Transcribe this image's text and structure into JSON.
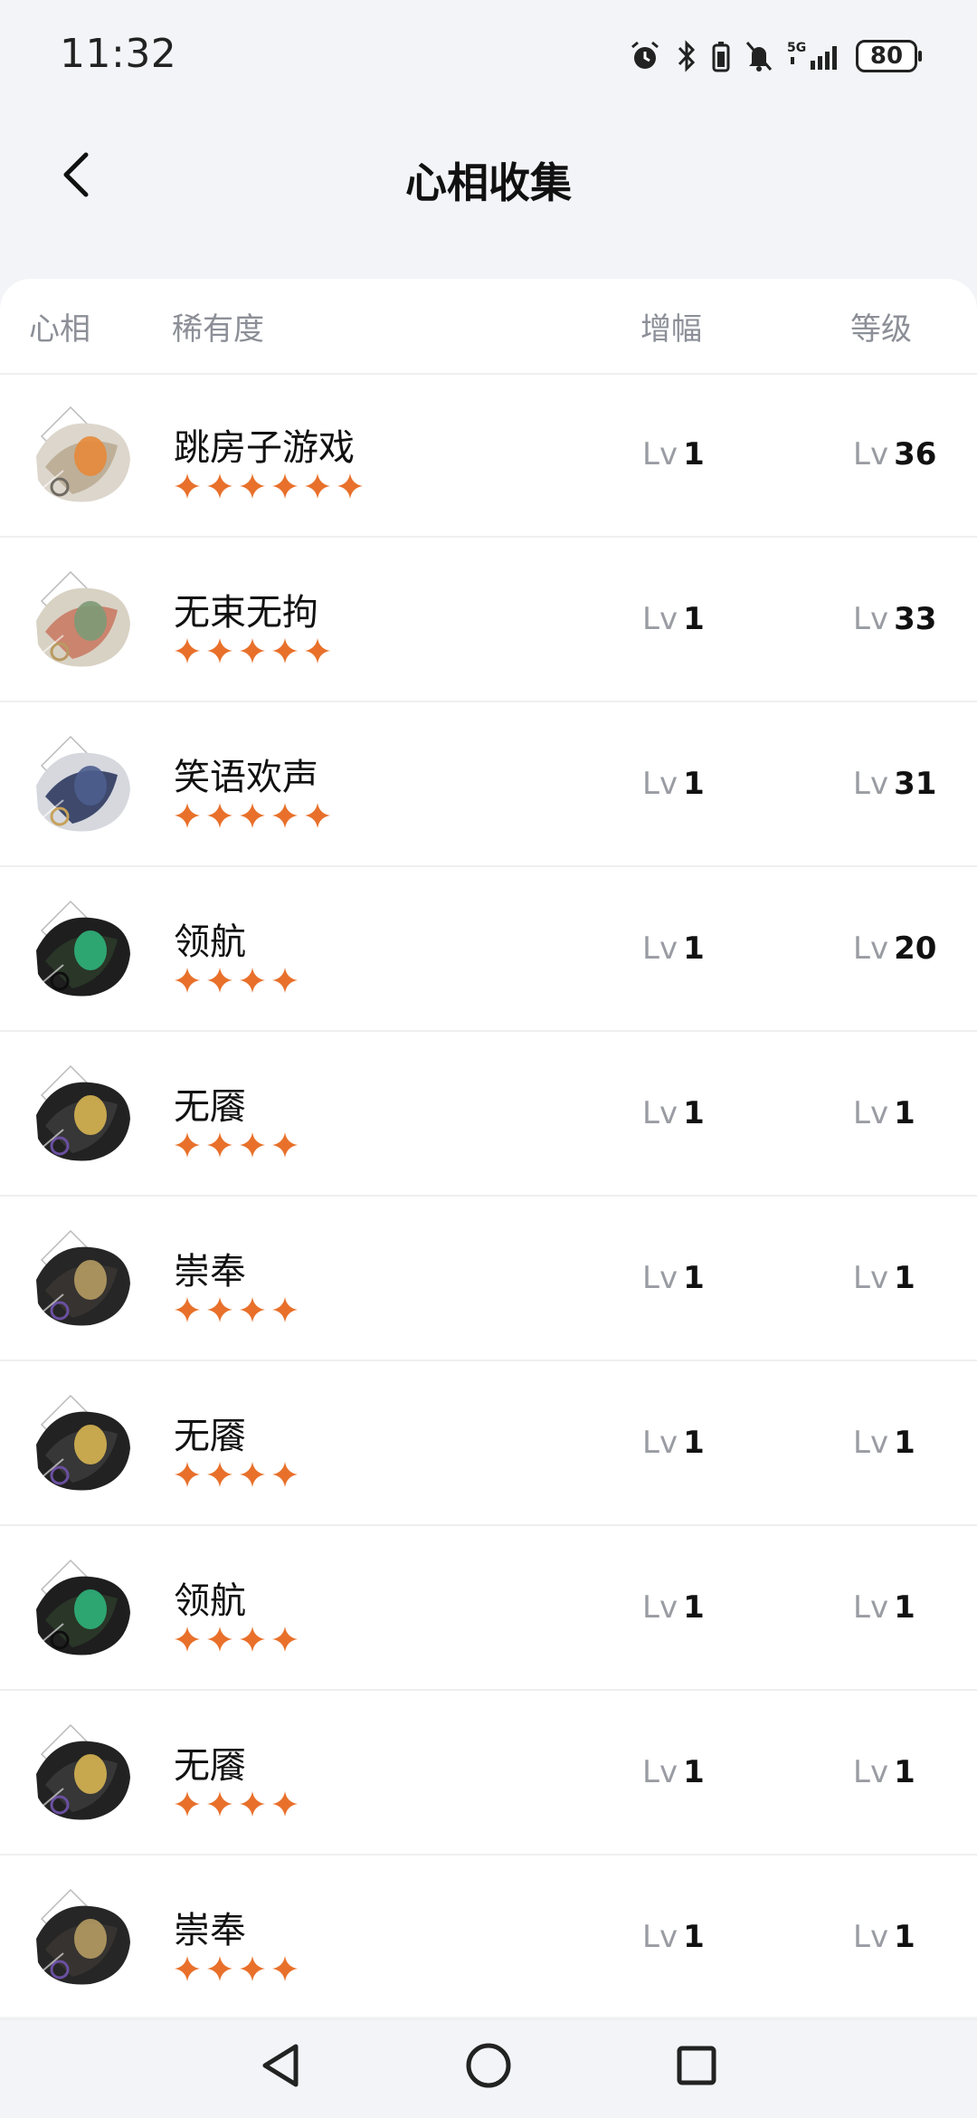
{
  "status": {
    "time": "11:32",
    "battery": "80",
    "network": "5G"
  },
  "header": {
    "title": "心相收集"
  },
  "table": {
    "columns": [
      "心相",
      "稀有度",
      "增幅",
      "等级"
    ],
    "lv_prefix": "Lv",
    "rows": [
      {
        "name": "跳房子游戏",
        "stars": 6,
        "boost": "1",
        "level": "36",
        "art": "hop"
      },
      {
        "name": "无束无拘",
        "stars": 5,
        "boost": "1",
        "level": "33",
        "art": "free"
      },
      {
        "name": "笑语欢声",
        "stars": 5,
        "boost": "1",
        "level": "31",
        "art": "laugh"
      },
      {
        "name": "领航",
        "stars": 4,
        "boost": "1",
        "level": "20",
        "art": "pilot"
      },
      {
        "name": "无餍",
        "stars": 4,
        "boost": "1",
        "level": "1",
        "art": "coin"
      },
      {
        "name": "崇奉",
        "stars": 4,
        "boost": "1",
        "level": "1",
        "art": "worship"
      },
      {
        "name": "无餍",
        "stars": 4,
        "boost": "1",
        "level": "1",
        "art": "coin"
      },
      {
        "name": "领航",
        "stars": 4,
        "boost": "1",
        "level": "1",
        "art": "pilot"
      },
      {
        "name": "无餍",
        "stars": 4,
        "boost": "1",
        "level": "1",
        "art": "coin"
      },
      {
        "name": "崇奉",
        "stars": 4,
        "boost": "1",
        "level": "1",
        "art": "worship"
      }
    ]
  },
  "colors": {
    "star": "#e8702a",
    "accent_text": "#111111",
    "muted": "#9a9ca3"
  },
  "system_nav": [
    "back-triangle-icon",
    "home-circle-icon",
    "recents-square-icon"
  ]
}
